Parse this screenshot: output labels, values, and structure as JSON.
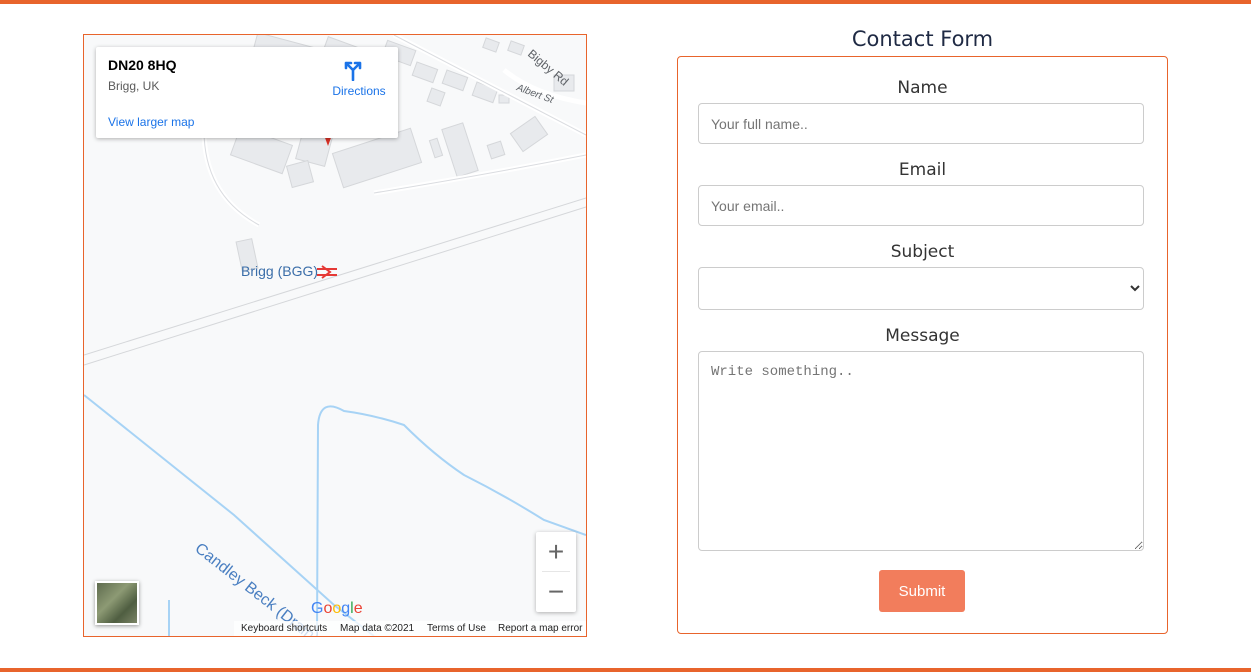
{
  "theme": {
    "accent": "#e8642c",
    "button": "#f27d5c",
    "link": "#1a73e8"
  },
  "map": {
    "place_title": "DN20 8HQ",
    "place_subtitle": "Brigg, UK",
    "directions_label": "Directions",
    "view_larger_label": "View larger map",
    "station_label": "Brigg (BGG)",
    "road_label_1": "Bigby Rd",
    "road_label_2": "Albert St",
    "drain_label": "Candley Beck (Drain)",
    "zoom_in": "+",
    "zoom_out": "−",
    "logo_letters": [
      "G",
      "o",
      "o",
      "g",
      "l",
      "e"
    ],
    "attribution": {
      "shortcuts": "Keyboard shortcuts",
      "data": "Map data ©2021",
      "terms": "Terms of Use",
      "report": "Report a map error"
    }
  },
  "form": {
    "title": "Contact Form",
    "name_label": "Name",
    "name_placeholder": "Your full name..",
    "email_label": "Email",
    "email_placeholder": "Your email..",
    "subject_label": "Subject",
    "subject_value": "",
    "message_label": "Message",
    "message_placeholder": "Write something..",
    "submit_label": "Submit"
  }
}
